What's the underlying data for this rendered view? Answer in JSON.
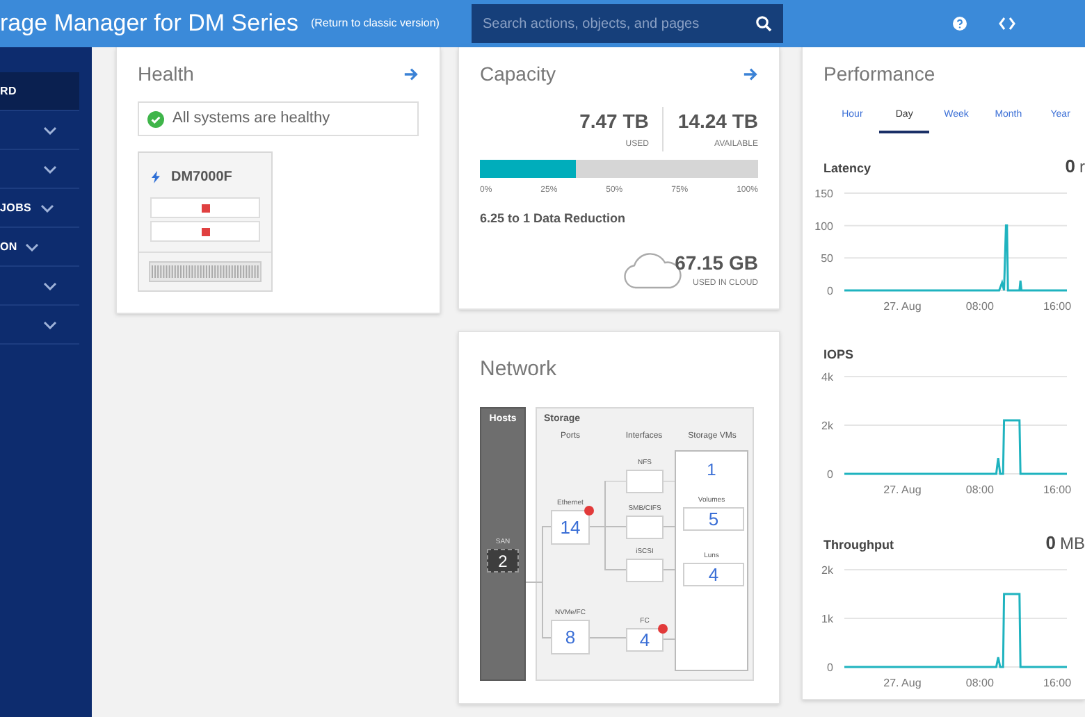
{
  "header": {
    "title": "rage Manager for DM Series",
    "link": "(Return to classic version)",
    "search": {
      "placeholder": "Search actions, objects, and pages"
    }
  },
  "sidebar": {
    "items": [
      {
        "label": "RD",
        "selected": true,
        "expandable": false
      },
      {
        "selected": false,
        "expandable": true
      },
      {
        "selected": false,
        "expandable": true
      },
      {
        "label": "JOBS",
        "selected": false,
        "expandable": true
      },
      {
        "label": "ON",
        "selected": false,
        "expandable": true
      },
      {
        "selected": false,
        "expandable": true
      },
      {
        "selected": false,
        "expandable": true
      }
    ]
  },
  "health": {
    "title": "Health",
    "status": "All systems are healthy",
    "healthy": true,
    "device": {
      "name": "DM7000F",
      "alerts": [
        {
          "color": "#e04040"
        },
        {
          "color": "#e04040"
        }
      ]
    }
  },
  "capacity": {
    "title": "Capacity",
    "used": {
      "value": "7.47 TB",
      "label": "USED"
    },
    "available": {
      "value": "14.24 TB",
      "label": "AVAILABLE"
    },
    "level": 0.345,
    "ticks": [
      "0%",
      "25%",
      "50%",
      "75%",
      "100%"
    ],
    "reduction": "6.25 to 1 Data Reduction",
    "cloud": {
      "value": "67.15 GB",
      "label": "USED IN CLOUD"
    }
  },
  "network": {
    "title": "Network",
    "hosts": {
      "title": "Hosts",
      "label": "SAN",
      "value": "2"
    },
    "storage": {
      "title": "Storage",
      "columns": [
        "Ports",
        "Interfaces",
        "Storage VMs"
      ],
      "ports": [
        {
          "label": "Ethernet",
          "value": "14",
          "alert": true
        },
        {
          "label": "NVMe/FC",
          "value": "8",
          "alert": false
        }
      ],
      "interfaces": [
        {
          "label": "NFS",
          "alert": false
        },
        {
          "label": "SMB/CIFS",
          "alert": false
        },
        {
          "label": "iSCSI",
          "alert": false
        },
        {
          "label": "FC",
          "value": "4",
          "alert": true
        }
      ],
      "vms": {
        "value": "1",
        "volumes": {
          "label": "Volumes",
          "value": "5"
        },
        "luns": {
          "label": "Luns",
          "value": "4"
        }
      }
    }
  },
  "performance": {
    "title": "Performance",
    "tabs": [
      {
        "label": "Hour",
        "selected": false
      },
      {
        "label": "Day",
        "selected": true
      },
      {
        "label": "Week",
        "selected": false
      },
      {
        "label": "Month",
        "selected": false
      },
      {
        "label": "Year",
        "selected": false
      }
    ],
    "metrics": [
      {
        "value": "0",
        "unit": "r",
        "chart_data": {
          "type": "line",
          "title": "Latency",
          "x": [
            -6,
            10,
            10.3,
            10.5,
            10.7,
            10.8,
            10.9,
            11.1,
            12.1,
            12.2,
            12.3,
            17
          ],
          "xlim": [
            -6,
            17
          ],
          "ylim": [
            0,
            150
          ],
          "yticks": [
            {
              "value": 0,
              "label": "0"
            },
            {
              "value": 50,
              "label": "50"
            },
            {
              "value": 100,
              "label": "100"
            },
            {
              "value": 150,
              "label": "150"
            }
          ],
          "xticks": [
            {
              "value": 0,
              "label": "27. Aug"
            },
            {
              "value": 8,
              "label": "08:00"
            },
            {
              "value": 16,
              "label": "16:00"
            }
          ],
          "series": [
            {
              "color": "#1fb3bf",
              "values": [
                0,
                0,
                12,
                0,
                100,
                100,
                0,
                0,
                0,
                15,
                0,
                0
              ]
            }
          ]
        }
      },
      {
        "chart_data": {
          "type": "line",
          "title": "IOPS",
          "x": [
            -6,
            9.7,
            9.9,
            10.1,
            10.4,
            10.5,
            12.1,
            12.2,
            17
          ],
          "xlim": [
            -6,
            17
          ],
          "ylim": [
            0,
            4000
          ],
          "yticks": [
            {
              "value": 0,
              "label": "0"
            },
            {
              "value": 2000,
              "label": "2k"
            },
            {
              "value": 4000,
              "label": "4k"
            }
          ],
          "xticks": [
            {
              "value": 0,
              "label": "27. Aug"
            },
            {
              "value": 8,
              "label": "08:00"
            },
            {
              "value": 16,
              "label": "16:00"
            }
          ],
          "series": [
            {
              "color": "#1fb3bf",
              "values": [
                0,
                0,
                650,
                0,
                0,
                2200,
                2200,
                0,
                0
              ]
            }
          ]
        }
      },
      {
        "value": "0",
        "unit": "MB",
        "chart_data": {
          "type": "line",
          "title": "Throughput",
          "x": [
            -6,
            9.7,
            9.9,
            10.1,
            10.4,
            10.5,
            12.1,
            12.2,
            17
          ],
          "xlim": [
            -6,
            17
          ],
          "ylim": [
            0,
            2000
          ],
          "yticks": [
            {
              "value": 0,
              "label": "0"
            },
            {
              "value": 1000,
              "label": "1k"
            },
            {
              "value": 2000,
              "label": "2k"
            }
          ],
          "xticks": [
            {
              "value": 0,
              "label": "27. Aug"
            },
            {
              "value": 8,
              "label": "08:00"
            },
            {
              "value": 16,
              "label": "16:00"
            }
          ],
          "series": [
            {
              "color": "#1fb3bf",
              "values": [
                0,
                0,
                200,
                0,
                0,
                1500,
                1500,
                0,
                0
              ]
            }
          ]
        }
      }
    ]
  }
}
